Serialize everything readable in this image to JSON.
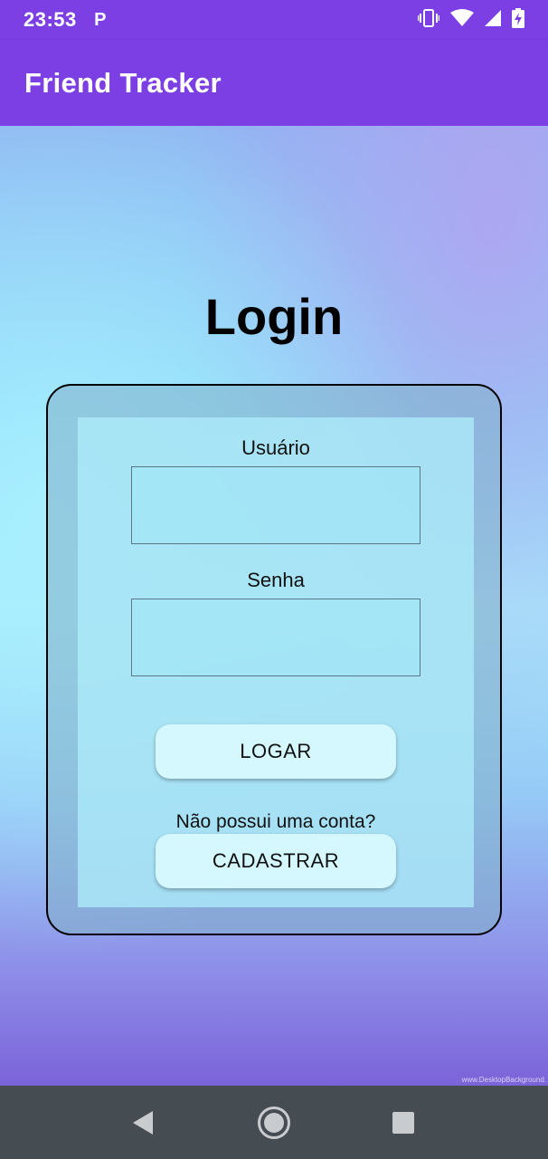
{
  "status_bar": {
    "time": "23:53",
    "parking_icon_label": "P",
    "icons": [
      "vibrate-icon",
      "wifi-icon",
      "signal-icon",
      "battery-charging-icon"
    ]
  },
  "app_bar": {
    "title": "Friend Tracker",
    "color": "#7B3FE4"
  },
  "login": {
    "title": "Login",
    "username_label": "Usuário",
    "username_value": "",
    "password_label": "Senha",
    "password_value": "",
    "login_button": "LOGAR",
    "no_account_text": "Não possui uma conta?",
    "register_button": "CADASTRAR"
  },
  "background": {
    "watermark": "www.DesktopBackground."
  },
  "nav_bar": {
    "buttons": [
      "back-icon",
      "home-icon",
      "recents-icon"
    ]
  }
}
